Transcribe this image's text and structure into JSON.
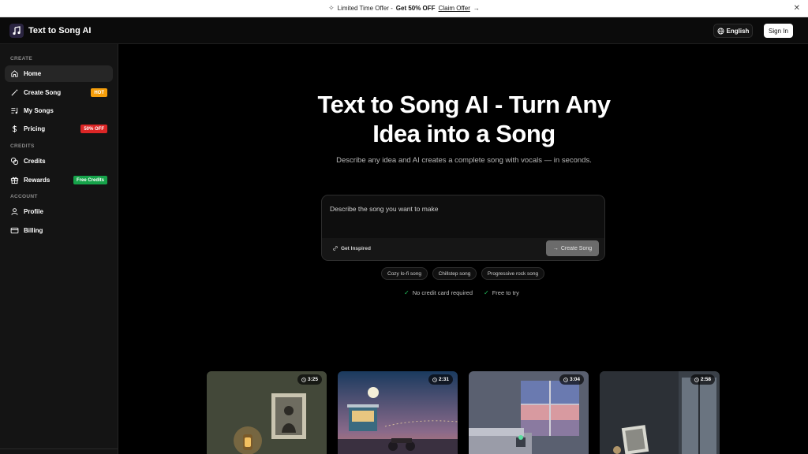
{
  "promo": {
    "text": "Limited Time Offer -",
    "offer": "Get 50% OFF",
    "claim": "Claim Offer"
  },
  "header": {
    "app_name": "Text to Song AI",
    "language": "English",
    "sign_in": "Sign In"
  },
  "sidebar": {
    "sections": [
      {
        "label": "CREATE"
      },
      {
        "label": "CREDITS"
      },
      {
        "label": "ACCOUNT"
      }
    ],
    "items": [
      {
        "label": "Home",
        "icon": "home-icon",
        "active": true
      },
      {
        "label": "Create Song",
        "icon": "wand-icon",
        "badge": "HOT"
      },
      {
        "label": "My Songs",
        "icon": "music-list-icon"
      },
      {
        "label": "Pricing",
        "icon": "dollar-icon",
        "badge": "50% OFF"
      },
      {
        "label": "Credits",
        "icon": "coins-icon"
      },
      {
        "label": "Rewards",
        "icon": "gift-icon",
        "badge": "Free Credits"
      },
      {
        "label": "Profile",
        "icon": "user-icon"
      },
      {
        "label": "Billing",
        "icon": "credit-card-icon"
      }
    ]
  },
  "hero": {
    "title_line1": "Text to Song AI - Turn Any",
    "title_line2": "Idea into a Song",
    "subtitle": "Describe any idea and AI creates a complete song with vocals — in seconds."
  },
  "prompt": {
    "placeholder": "Describe the song you want to make",
    "get_inspired": "Get Inspired",
    "create_button": "Create Song"
  },
  "chips": [
    "Cozy lo-fi song",
    "Chillstep song",
    "Progressive rock song"
  ],
  "checks": [
    "No credit card required",
    "Free to try"
  ],
  "cards": [
    {
      "duration": "3:25"
    },
    {
      "duration": "2:31"
    },
    {
      "duration": "3:04"
    },
    {
      "duration": "2:58"
    }
  ],
  "colors": {
    "hot_badge": "#f59e0b",
    "off_badge": "#dc2626",
    "free_badge": "#16a34a",
    "check": "#22c55e"
  }
}
